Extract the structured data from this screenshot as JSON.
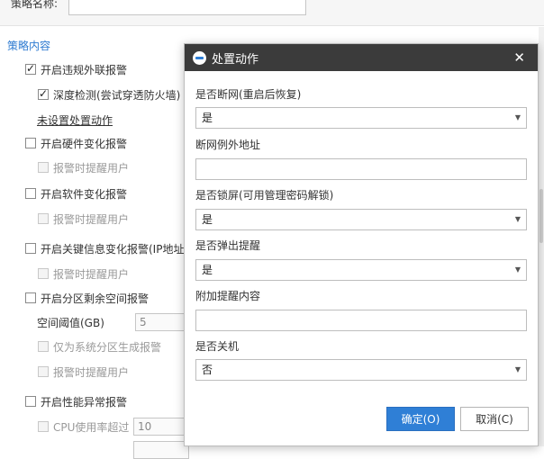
{
  "form": {
    "name_label": "策略名称:",
    "section_title": "策略内容",
    "items": {
      "illegal_outreach": "开启违规外联报警",
      "deep_detect": "深度检测(尝试穿透防火墙)",
      "unset_action": "未设置处置动作",
      "hardware_change": "开启硬件变化报警",
      "hw_notify": "报警时提醒用户",
      "software_change": "开启软件变化报警",
      "sw_notify": "报警时提醒用户",
      "key_info_change": "开启关键信息变化报警(IP地址",
      "ki_notify": "报警时提醒用户",
      "partition_space": "开启分区剩余空间报警",
      "space_threshold_label": "空间阈值(GB)",
      "space_threshold_value": "5",
      "system_only": "仅为系统分区生成报警",
      "ps_notify": "报警时提醒用户",
      "performance": "开启性能异常报警",
      "cpu_label": "CPU使用率超过",
      "cpu_value": "10"
    }
  },
  "dialog": {
    "title": "处置动作",
    "disconnect_label": "是否断网(重启后恢复)",
    "disconnect_value": "是",
    "exception_label": "断网例外地址",
    "lock_label": "是否锁屏(可用管理密码解锁)",
    "lock_value": "是",
    "popup_label": "是否弹出提醒",
    "popup_value": "是",
    "extra_label": "附加提醒内容",
    "shutdown_label": "是否关机",
    "shutdown_value": "否",
    "ok_button": "确定(O)",
    "cancel_button": "取消(C)"
  },
  "colors": {
    "accent": "#2f7fd6",
    "titlebar": "#3b3b3b",
    "section": "#2e7bd1"
  }
}
